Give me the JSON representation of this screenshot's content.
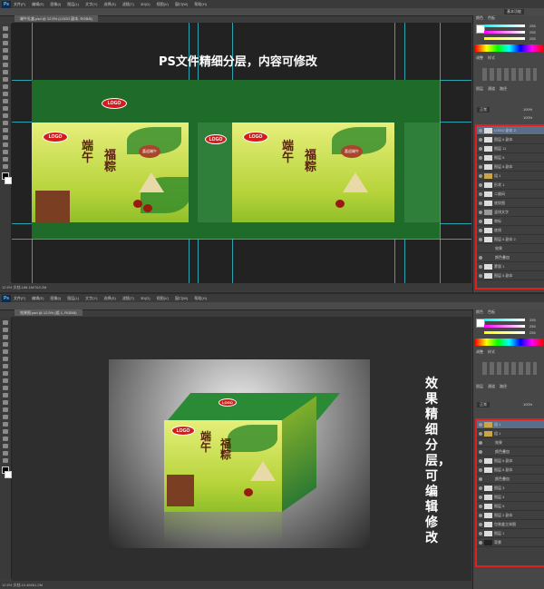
{
  "top": {
    "menu": [
      "文件(F)",
      "编辑(E)",
      "图像(I)",
      "图层(L)",
      "文字(Y)",
      "选择(S)",
      "滤镜(T)",
      "3D(D)",
      "视图(V)",
      "窗口(W)",
      "帮助(H)"
    ],
    "ps_logo": "Ps",
    "doc_tab": "端午礼盒.psd @ 12.5% (LOGO 副本, RGB/8)",
    "status": "12.5%   文档:186.1M/763.2M",
    "workspace": "基本功能",
    "caption": "PS文件精细分层，内容可修改",
    "color_values": [
      "255",
      "255",
      "255"
    ],
    "panel_tabs": {
      "color": "颜色",
      "swatches": "色板",
      "adjust": "调整",
      "styles": "样式",
      "layers": "图层",
      "channels": "通道",
      "paths": "路径"
    },
    "layers": [
      "LOGO 副本 2",
      "图层 6 副本",
      "图层 11",
      "图层 5",
      "图层 8 副本",
      "组 1",
      "形状 1",
      "二维码",
      "底纹图",
      "竖排文字",
      "商标",
      "底线",
      "图层 6 副本 2",
      "效果",
      "颜色叠加",
      "蒙版 1",
      "图层 5 副本"
    ],
    "opacity": "100%",
    "fill": "100%",
    "blend": "正常"
  },
  "package": {
    "logo": "LOGO",
    "title_chars": [
      "端",
      "午",
      "福",
      "粽"
    ],
    "seal": "喜迎端午"
  },
  "bottom": {
    "menu": [
      "文件(F)",
      "编辑(E)",
      "图像(I)",
      "图层(L)",
      "文字(Y)",
      "选择(S)",
      "滤镜(T)",
      "3D(D)",
      "视图(V)",
      "窗口(W)",
      "帮助(H)"
    ],
    "ps_logo": "Ps",
    "doc_tab": "效果图.psd @ 12.5% (组 1, RGB/8)",
    "status": "12.5%   文档:10.4M/61.2M",
    "caption": "效果精细分层，可编辑修改",
    "layers": [
      "组 1",
      "组 1",
      "效果",
      "颜色叠加",
      "图层 6 副本",
      "图层 6 副本",
      "颜色叠加",
      "图层 3",
      "图层 4",
      "图层 5",
      "图层 2 副本",
      "包装盒立体图",
      "图层 1",
      "背景"
    ]
  }
}
